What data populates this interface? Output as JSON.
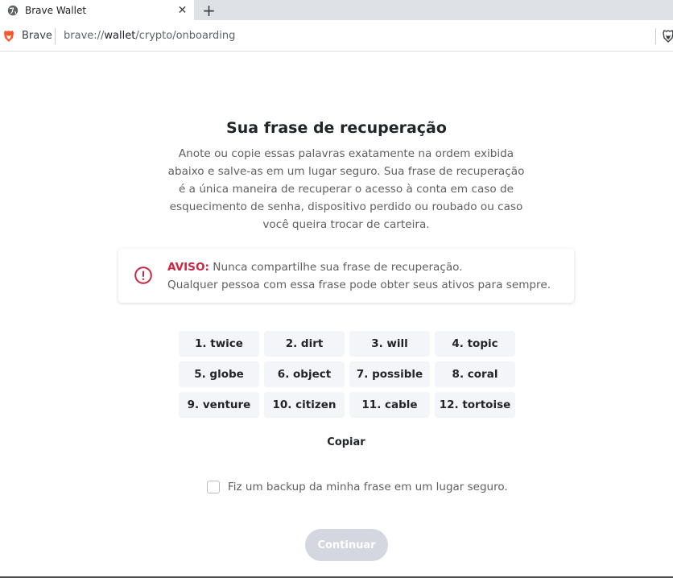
{
  "browser": {
    "tab_title": "Brave Wallet",
    "close_glyph": "✕",
    "new_tab_glyph": "+",
    "site_name": "Brave",
    "url_prefix": "brave://",
    "url_host": "wallet",
    "url_path": "/crypto/onboarding"
  },
  "page": {
    "title": "Sua frase de recuperação",
    "description": "Anote ou copie essas palavras exatamente na ordem exibida abaixo e salve-as em um lugar seguro. Sua frase de recuperação é a única maneira de recuperar o acesso à conta em caso de esquecimento de senha, dispositivo perdido ou roubado ou caso você queira trocar de carteira.",
    "warning": {
      "label": "AVISO:",
      "line1": " Nunca compartilhe sua frase de recuperação.",
      "line2": "Qualquer pessoa com essa frase pode obter seus ativos para sempre.",
      "icon": "alert-circle-icon",
      "color": "#c92744"
    },
    "words": [
      "1. twice",
      "2. dirt",
      "3. will",
      "4. topic",
      "5. globe",
      "6. object",
      "7. possible",
      "8. coral",
      "9. venture",
      "10. citizen",
      "11. cable",
      "12. tortoise"
    ],
    "copy_label": "Copiar",
    "backup_label": "Fiz um backup da minha frase em um lugar seguro.",
    "backup_checked": false,
    "continue_label": "Continuar",
    "continue_enabled": false,
    "continue_color": "#d4d6e0"
  }
}
